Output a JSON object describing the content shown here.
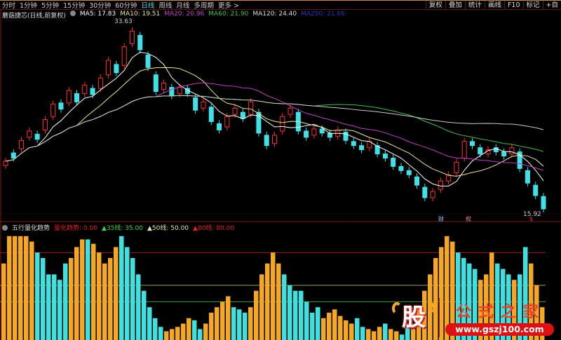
{
  "topbar": {
    "periods": [
      "分时",
      "1分钟",
      "5分钟",
      "15分钟",
      "30分钟",
      "60分钟",
      "日线",
      "周线",
      "月线",
      "多周期",
      "更多 >"
    ],
    "active_period": "日线",
    "tools": [
      "复权",
      "叠加",
      "统计",
      "画线",
      "F10",
      "标记",
      "+自"
    ]
  },
  "main": {
    "title": "蘑菇捷芯(日线,前复权)",
    "ma_labels": [
      {
        "text": "MA5: 17.83",
        "color": "#ffffff"
      },
      {
        "text": "MA10: 19.51",
        "color": "#f0e68c"
      },
      {
        "text": "MA20: 20.96",
        "color": "#c040c0"
      },
      {
        "text": "MA60: 21.90",
        "color": "#40c040"
      },
      {
        "text": "MA120: 24.40",
        "color": "#dddddd"
      },
      {
        "text": "MA250: 21.66",
        "color": "#3030c0"
      }
    ],
    "high_label": "33.63",
    "low_label": "15.92",
    "markers": [
      "财",
      "权",
      "$"
    ]
  },
  "chart_data": {
    "type": "candlestick",
    "price_range": [
      15.92,
      33.63
    ],
    "closes": [
      20.5,
      20.8,
      22.5,
      23.4,
      22.6,
      24.5,
      26.0,
      25.5,
      27.3,
      26.2,
      27.8,
      26.9,
      28.5,
      30.2,
      29.0,
      31.5,
      33.0,
      31.2,
      29.5,
      27.2,
      28.0,
      26.8,
      27.6,
      27.0,
      25.4,
      26.2,
      24.3,
      23.5,
      24.8,
      25.6,
      24.6,
      26.2,
      23.2,
      22.0,
      23.0,
      24.8,
      25.6,
      23.4,
      22.8,
      23.6,
      23.2,
      22.8,
      23.5,
      22.5,
      22.0,
      21.6,
      22.4,
      21.2,
      20.8,
      20.0,
      19.6,
      19.2,
      18.2,
      17.0,
      17.6,
      18.6,
      19.2,
      20.4,
      22.4,
      22.0,
      21.2,
      21.6,
      21.4,
      21.0,
      21.8,
      19.8,
      18.4,
      17.2,
      15.92
    ],
    "opens_offset": [
      -0.4,
      0.5,
      -0.8,
      -0.6,
      0.5,
      -1,
      -1.2,
      0.6,
      -1.2,
      0.8,
      -0.8,
      0.6,
      -1,
      -1.4,
      0.8,
      -1.8,
      -1.2,
      1.4,
      1.2,
      1.6,
      -0.6,
      0.8,
      -0.6,
      0.5,
      1.2,
      -0.6,
      1.4,
      0.6,
      -1,
      -0.6,
      0.6,
      -1.2,
      2,
      1,
      -0.8,
      -1.4,
      -0.6,
      1.8,
      0.6,
      -0.6,
      0.4,
      0.4,
      -0.6,
      0.8,
      0.4,
      0.4,
      -0.6,
      0.8,
      0.4,
      0.8,
      0.4,
      0.4,
      0.8,
      1,
      -0.6,
      -0.8,
      -0.6,
      -1,
      -1.6,
      0.4,
      0.6,
      -0.4,
      0.4,
      0.4,
      -0.6,
      1.6,
      1.2,
      1,
      1.2
    ],
    "indicator": {
      "name": "五行量化趋势",
      "labels": [
        {
          "text": "量化趋势: 0.00",
          "color": "#e02020"
        },
        {
          "text": "▲35线: 35.00",
          "color": "#40d040"
        },
        {
          "text": "▲50线: 50.00",
          "color": "#e0e0a0"
        },
        {
          "text": "▲80线: 80.00",
          "color": "#e02020"
        }
      ],
      "levels": [
        35,
        50,
        80
      ],
      "values": [
        70,
        95,
        95,
        95,
        95,
        90,
        80,
        75,
        60,
        60,
        55,
        70,
        75,
        85,
        92,
        92,
        88,
        80,
        70,
        75,
        85,
        95,
        85,
        75,
        60,
        45,
        30,
        20,
        12,
        8,
        10,
        12,
        15,
        20,
        18,
        10,
        15,
        25,
        30,
        35,
        40,
        30,
        28,
        25,
        30,
        45,
        60,
        70,
        80,
        70,
        60,
        50,
        45,
        45,
        35,
        25,
        30,
        20,
        25,
        28,
        22,
        18,
        15,
        20,
        12,
        10,
        8,
        12,
        15,
        10,
        8,
        5,
        15,
        10,
        30,
        45,
        60,
        75,
        85,
        95,
        90,
        80,
        75,
        70,
        65,
        55,
        60,
        80,
        70,
        65,
        60,
        55,
        60,
        85,
        70,
        50,
        30
      ],
      "colors": "ooooooccccccooocoooooccccccccoooooccooooocccoooooocccccccooooooccooocooccooooooooccccooocccocc"
    },
    "watermark": {
      "logo_char": "股",
      "text": "公式之家",
      "url": "www.gszj100.com"
    }
  }
}
